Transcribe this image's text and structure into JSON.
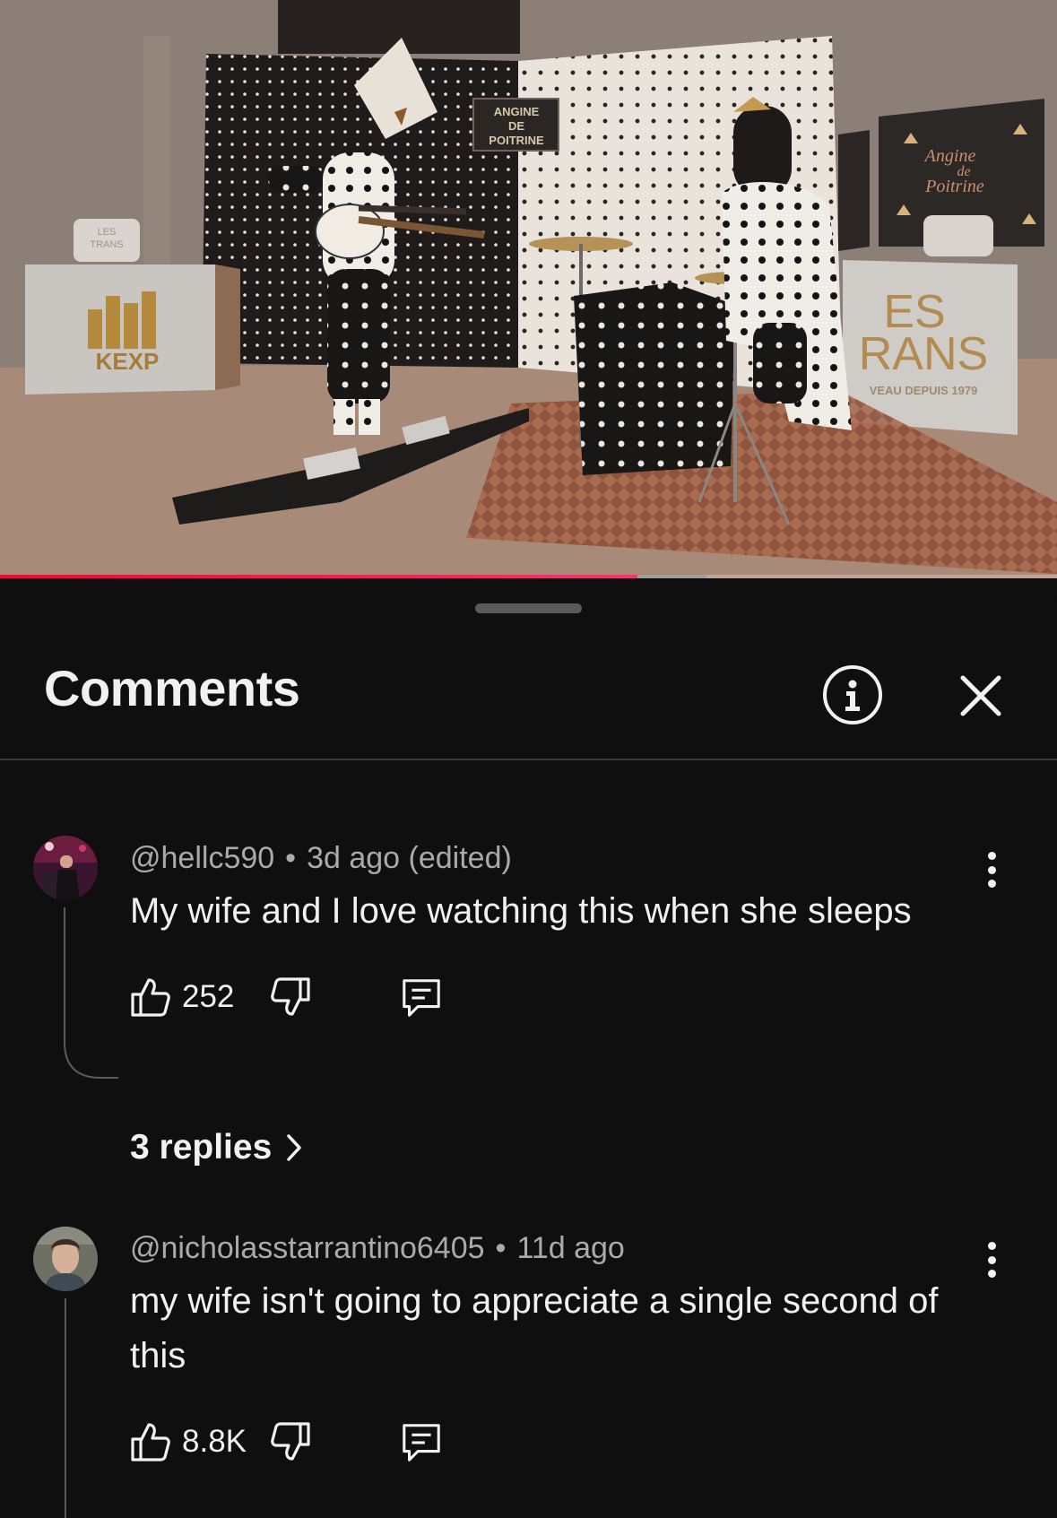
{
  "video": {
    "progress_played": 0.603,
    "progress_buffered": 0.668,
    "scene_text": {
      "banner": [
        "ANGINE",
        "DE",
        "POITRINE"
      ],
      "left_sign": "KEXP",
      "small_sign": [
        "LES",
        "TRANS"
      ],
      "right_sign_line1": "ES",
      "right_sign_line2": "RANS",
      "right_sign_line3": "VEAU DEPUIS 1979",
      "poster": [
        "Angine",
        "de",
        "Poitrine"
      ]
    }
  },
  "sheet": {
    "title": "Comments",
    "info_icon": "info-icon",
    "close_icon": "close-icon"
  },
  "comments": [
    {
      "author": "@hellc590",
      "time": "3d ago (edited)",
      "text": "My wife and I love watching this when she sleeps",
      "likes": "252",
      "replies_label": "3 replies"
    },
    {
      "author": "@nicholasstarrantino6405",
      "time": "11d ago",
      "text": "my wife isn't going to appreciate a single second of this",
      "likes": "8.8K"
    }
  ],
  "colors": {
    "background": "#0f0f0f",
    "text_primary": "#f1f1f1",
    "text_secondary": "#aaaaaa",
    "progress_red": "#ff0033"
  }
}
